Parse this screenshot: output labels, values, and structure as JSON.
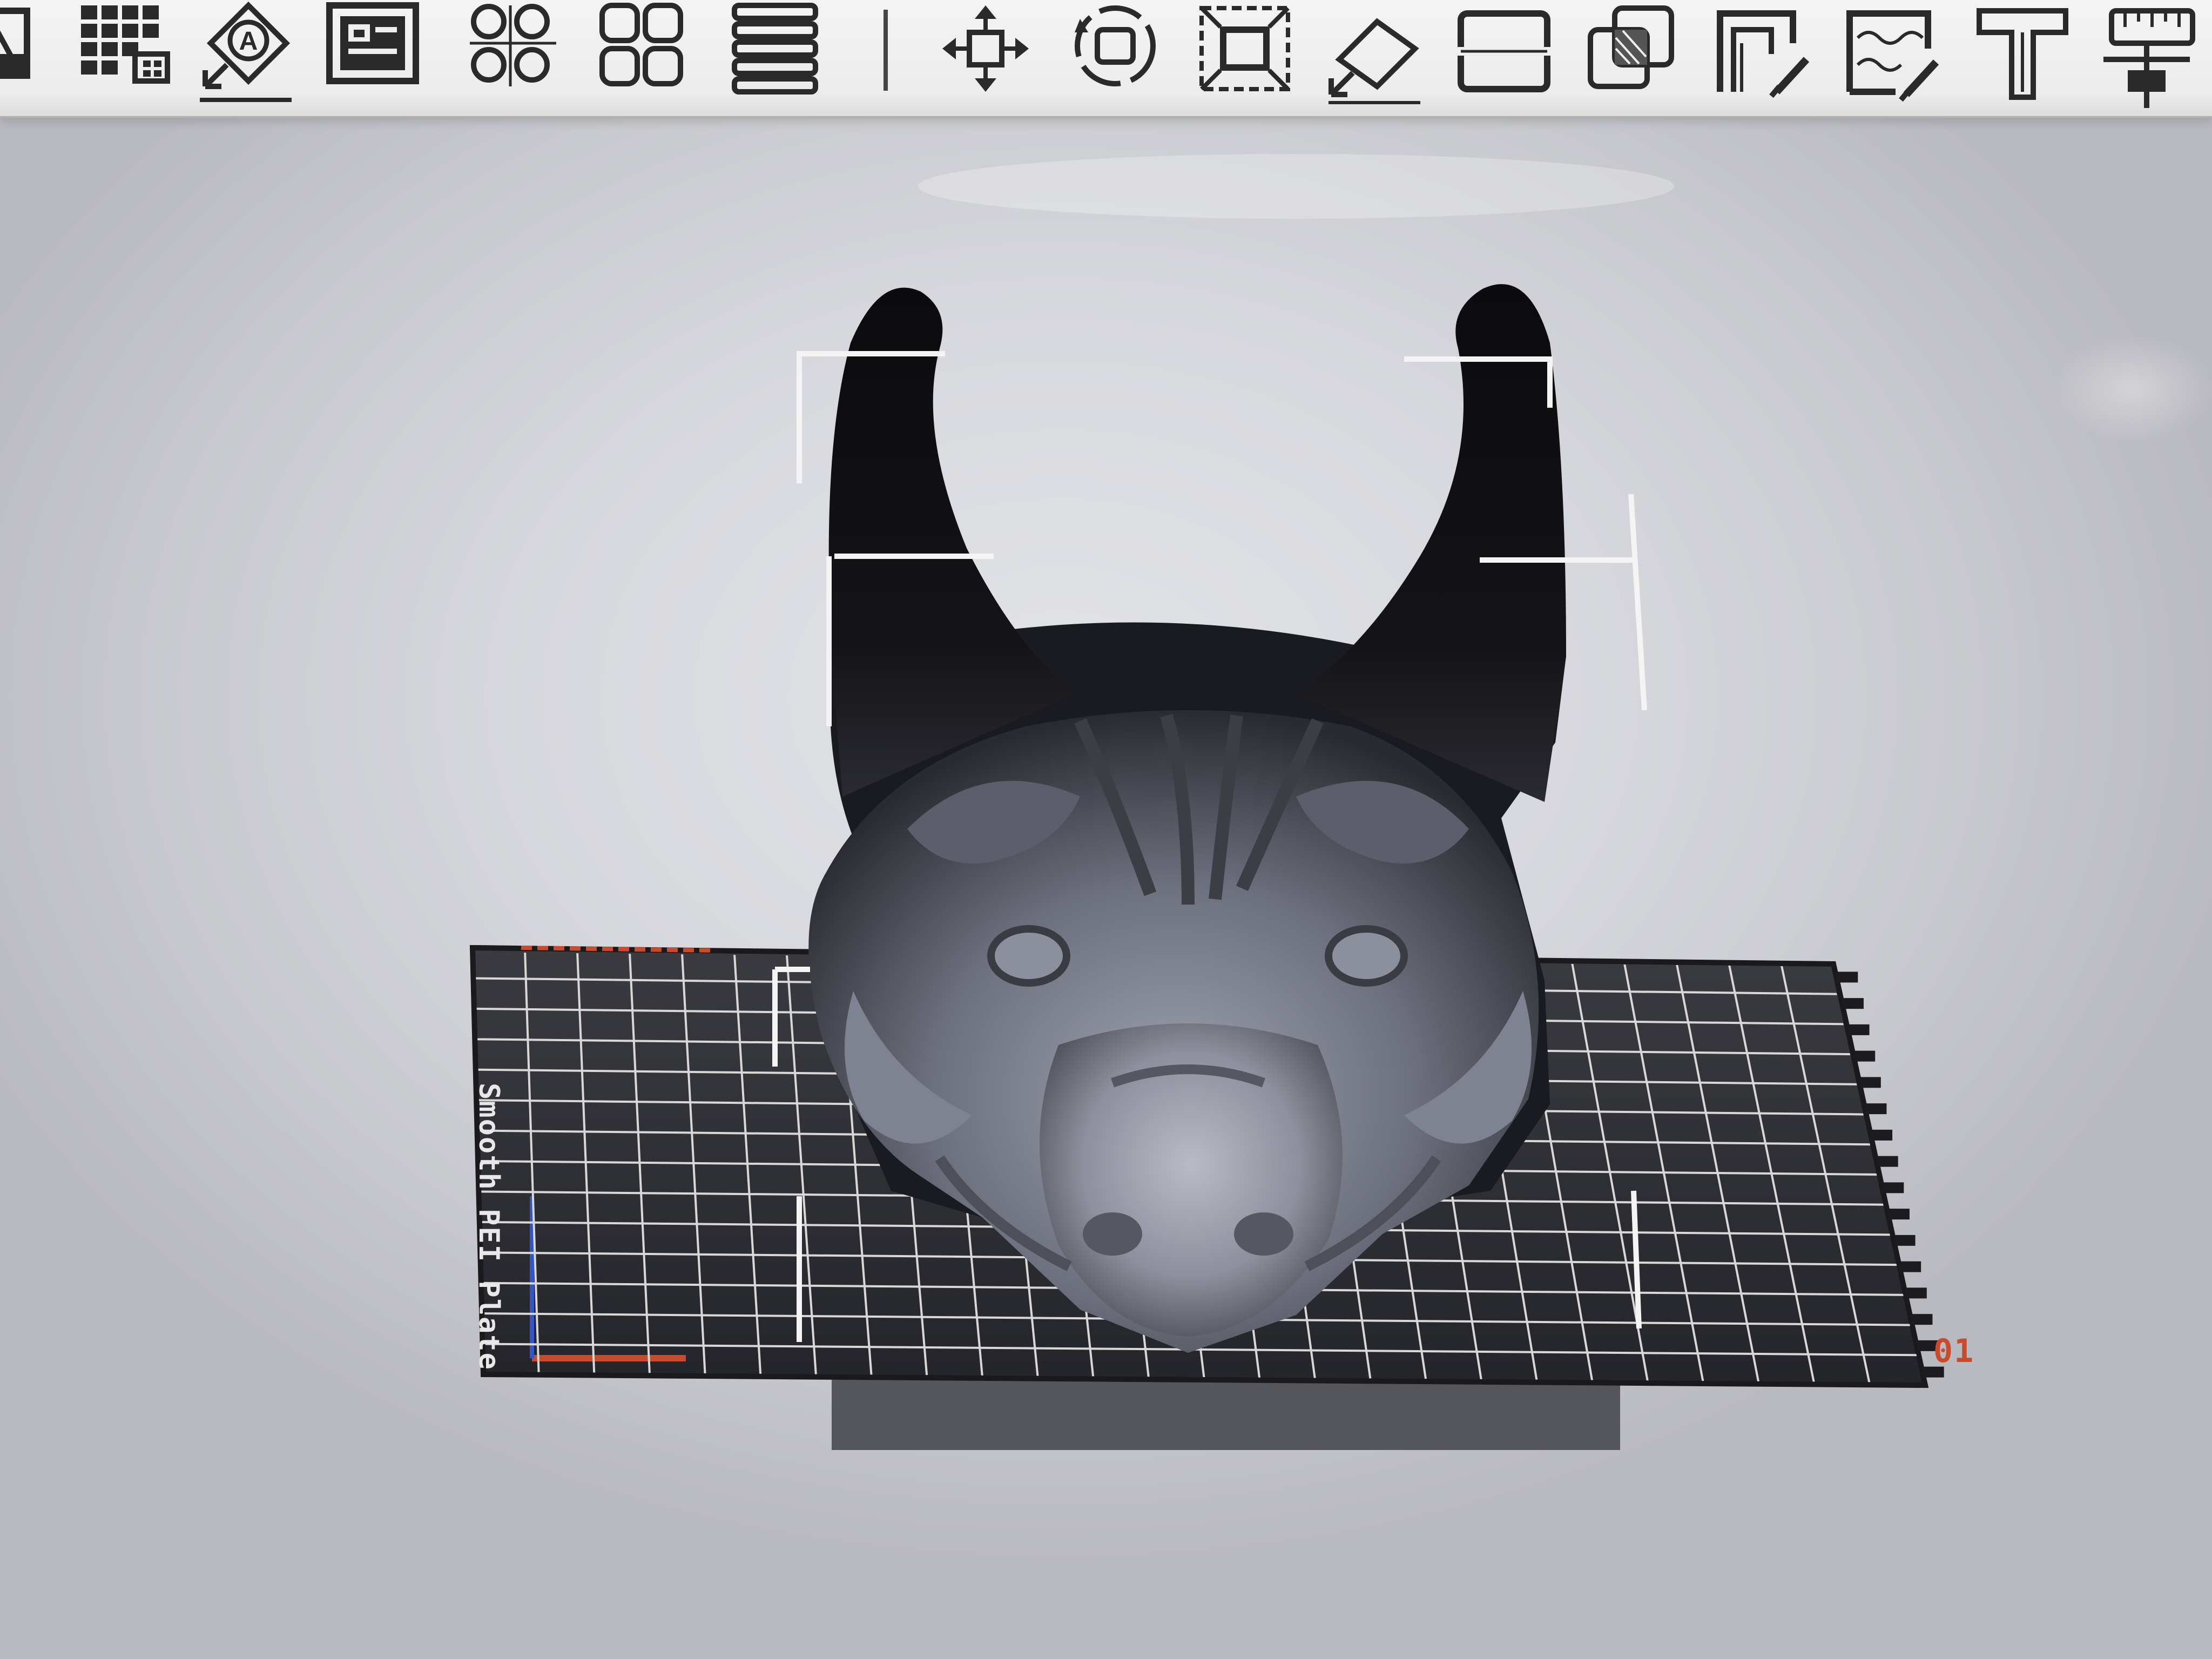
{
  "toolbar": {
    "tools": [
      {
        "id": "add",
        "icon": "add-part-icon"
      },
      {
        "id": "arrange",
        "icon": "grid-arrange-icon"
      },
      {
        "id": "auto-orient",
        "icon": "auto-orient-icon"
      },
      {
        "id": "plate",
        "icon": "plate-settings-icon"
      },
      {
        "id": "split-objects",
        "icon": "split-objects-icon"
      },
      {
        "id": "split-parts",
        "icon": "split-parts-icon"
      },
      {
        "id": "layers",
        "icon": "layers-icon"
      },
      {
        "id": "move",
        "icon": "move-icon"
      },
      {
        "id": "rotate",
        "icon": "rotate-icon"
      },
      {
        "id": "scale",
        "icon": "scale-icon"
      },
      {
        "id": "lay-on-face",
        "icon": "lay-on-face-icon"
      },
      {
        "id": "cut",
        "icon": "cut-icon"
      },
      {
        "id": "boolean",
        "icon": "boolean-icon"
      },
      {
        "id": "support-paint",
        "icon": "support-paint-icon"
      },
      {
        "id": "seam-paint",
        "icon": "seam-paint-icon"
      },
      {
        "id": "text",
        "icon": "text-icon"
      },
      {
        "id": "measure",
        "icon": "measure-icon"
      }
    ]
  },
  "viewport": {
    "model": {
      "name": "dragon-head-model"
    },
    "bed": {
      "title": "Smooth PEI Plate",
      "plate_number": "01"
    }
  },
  "colors": {
    "toolbar_bg": "#efefef",
    "icon": "#2a2a2a",
    "bed": "#2b2c30",
    "bed_grid": "#dcdcdc",
    "model": "#6e7180",
    "model_dark": "#17181c",
    "accent_red": "#c94a2c"
  }
}
